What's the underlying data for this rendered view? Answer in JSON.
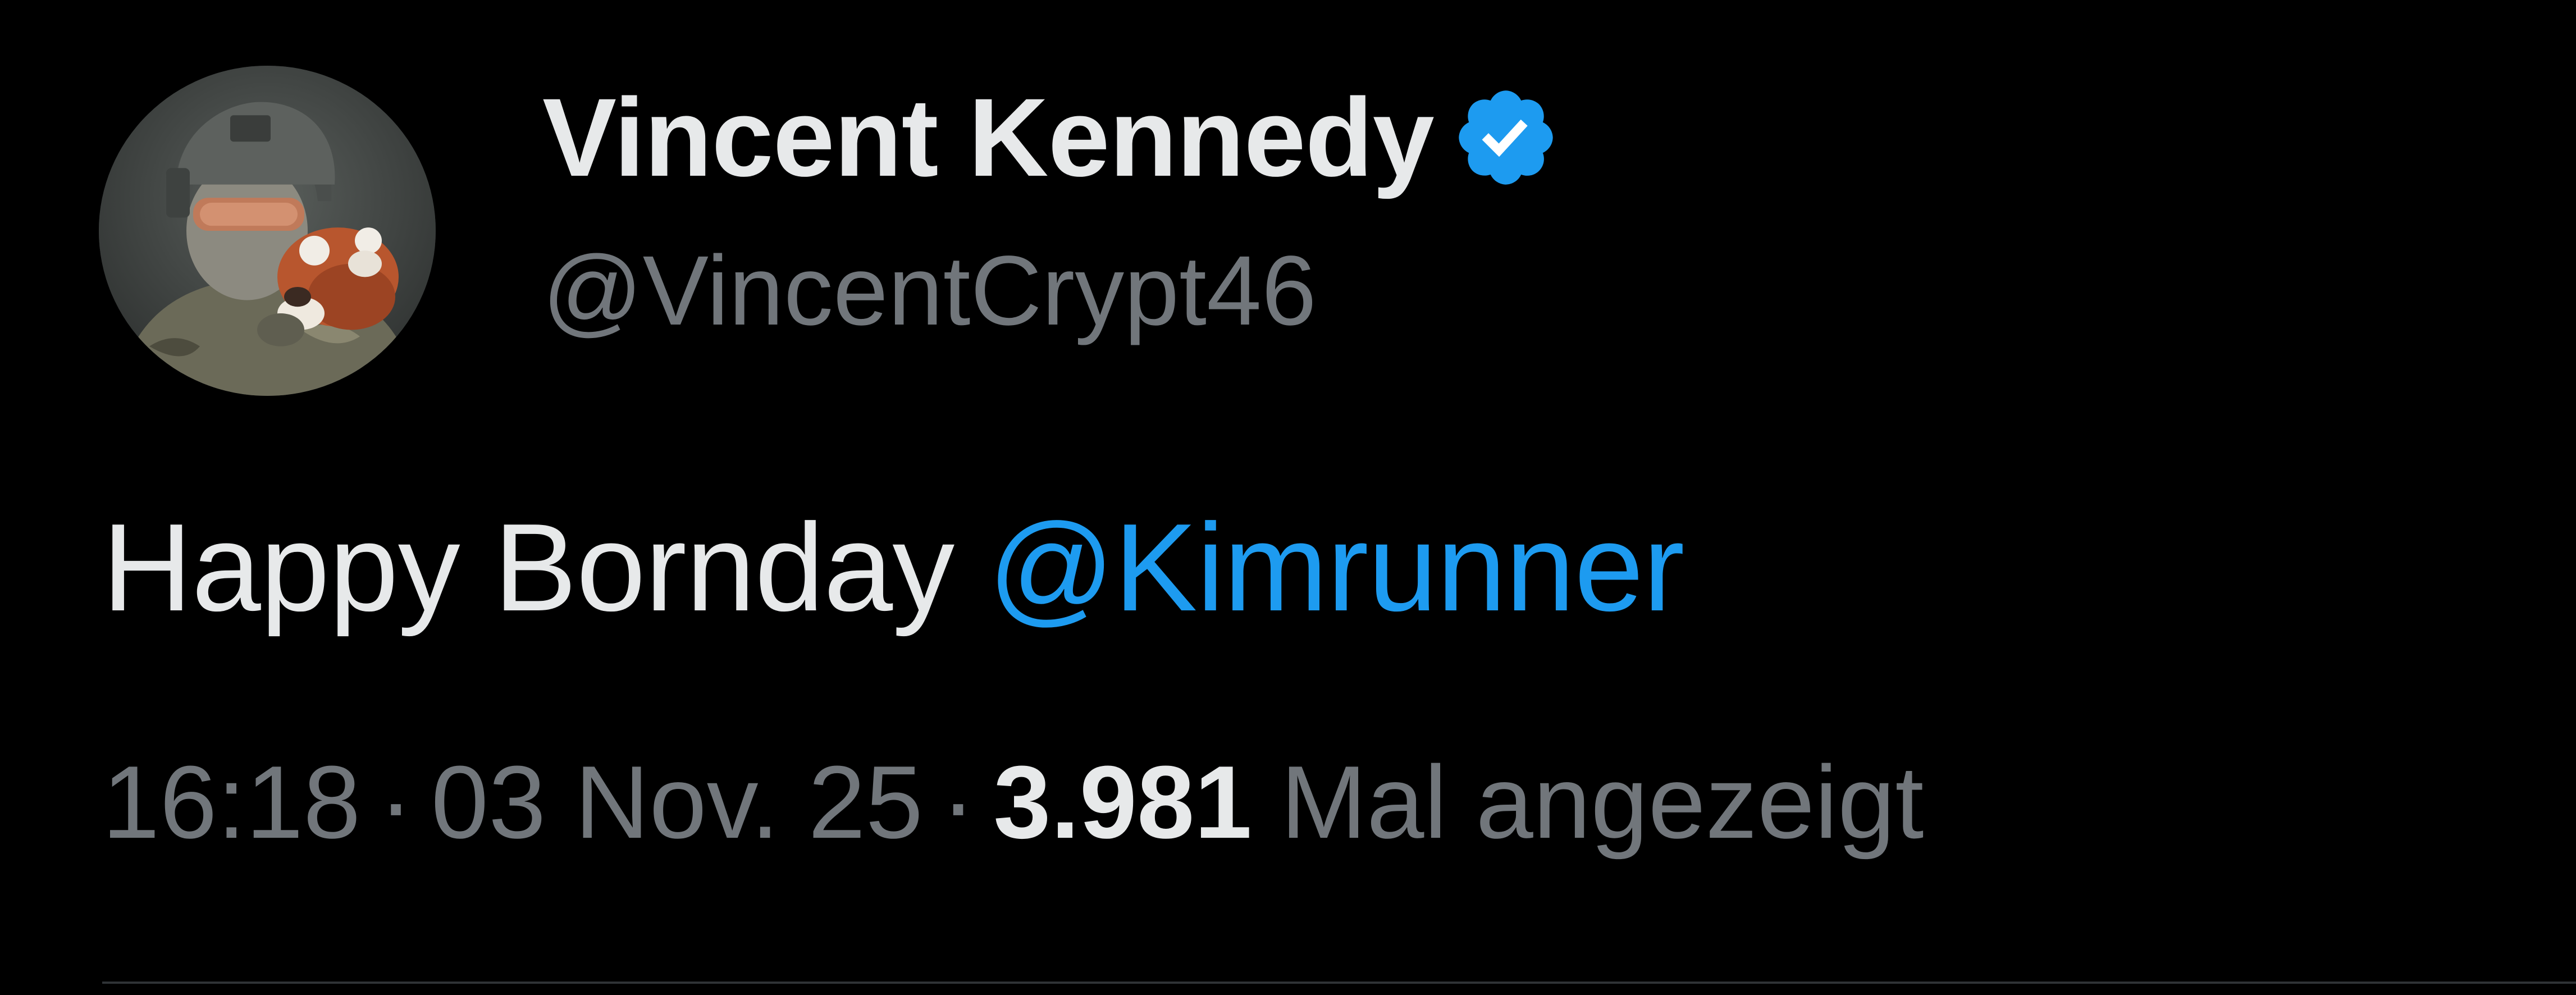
{
  "tweet": {
    "author": {
      "display_name": "Vincent Kennedy",
      "handle": "@VincentCrypt46",
      "verified": true,
      "avatar": "avatar-photo-soldier-with-red-panda"
    },
    "text": {
      "body": "Happy Bornday",
      "mention": "@Kimrunner"
    },
    "meta": {
      "time": "16:18",
      "separator": "·",
      "date": "03 Nov. 25",
      "views_count": "3.981",
      "views_label": "Mal angezeigt"
    }
  },
  "colors": {
    "background": "#000000",
    "primary_text": "#e7e9ea",
    "secondary_text": "#71767b",
    "accent": "#1d9bf0",
    "divider": "#2f3336"
  },
  "icons": {
    "verified": "verified-badge-icon"
  }
}
